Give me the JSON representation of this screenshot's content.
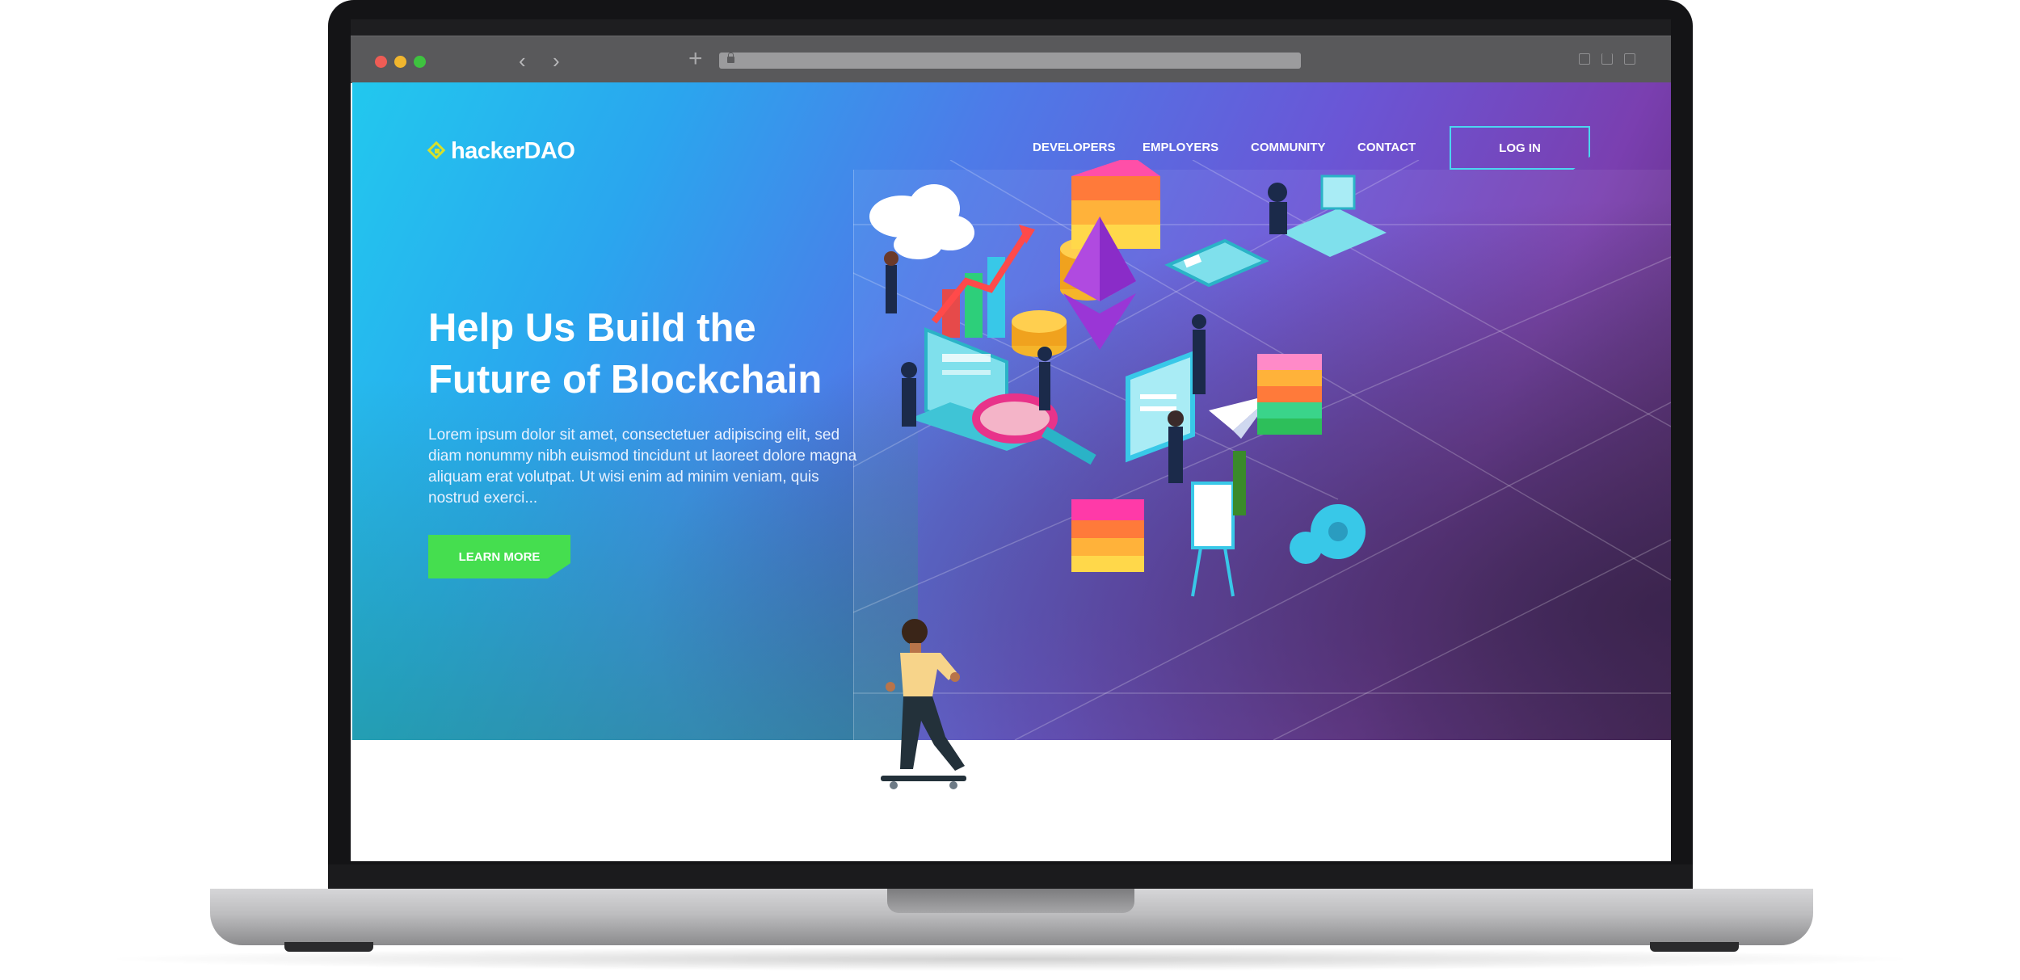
{
  "browser": {
    "back_icon": "chevron-left-icon",
    "forward_icon": "chevron-right-icon",
    "new_tab_icon": "plus-icon",
    "lock_icon": "lock-icon"
  },
  "site": {
    "logo_text": "hackerDAO",
    "nav": [
      {
        "label": "DEVELOPERS"
      },
      {
        "label": "EMPLOYERS"
      },
      {
        "label": "COMMUNITY"
      },
      {
        "label": "CONTACT"
      }
    ],
    "login_label": "LOG IN",
    "headline_line1": "Help Us Build the",
    "headline_line2": "Future of Blockchain",
    "body_text": "Lorem ipsum dolor sit amet, consectetuer adipiscing elit, sed diam nonummy nibh euismod tincidunt ut laoreet dolore magna aliquam erat volutpat. Ut wisi enim ad minim veniam, quis nostrud exerci...",
    "cta_label": "LEARN MORE"
  },
  "colors": {
    "accent_green": "#45de4f",
    "accent_cyan": "#4bd6f0",
    "logo_yellow": "#d6e02b",
    "hero_start": "#22c8ee",
    "hero_end": "#7a3fb0"
  }
}
